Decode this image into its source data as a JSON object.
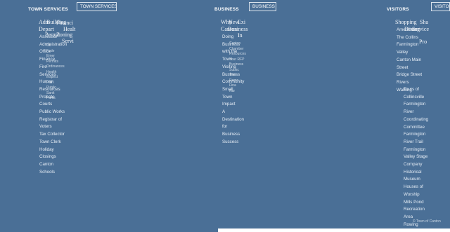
{
  "sections": {
    "town": {
      "header": "TOWN SERVICES",
      "dropdown": "TOWN SERVICES ▾",
      "overlap_title": [
        "Adm",
        "Building",
        "Financi",
        "Healt",
        "Servi",
        "Depart",
        "Permit",
        "Zoning"
      ],
      "items": [
        "Assessor",
        "Administration",
        "Office",
        "Finance",
        "Fire",
        "Services",
        "Human",
        "Resources",
        "Probate",
        "Courts",
        "Public Works",
        "Registrar of",
        "Voters",
        "Tax Collector",
        "Town Clerk",
        "Holiday",
        "Closings",
        "Canton",
        "Schools"
      ],
      "tiny_items": [
        "Cit",
        "Fede",
        "Emer",
        "Permits",
        "Ordinances",
        "Health",
        "Inspect",
        "Plan",
        "Public",
        "Sanit",
        "Parks"
      ]
    },
    "business": {
      "header": "BUSINESS",
      "dropdown": "BUSINESS ▾",
      "overlap_title": [
        "Why",
        "Canton",
        "New",
        "Business",
        "Exi",
        "In"
      ],
      "items": [
        "Doing",
        "Business",
        "with the",
        "Town",
        "Visiting",
        "Business",
        "Community",
        "Small",
        "Town",
        "Impact",
        "A",
        "Destination",
        "for",
        "Business",
        "Success"
      ],
      "tiny_items": [
        "Canton",
        "Chamber",
        "Resources",
        "Your RFP",
        "Business",
        "Subsc",
        "Tran",
        "Remo",
        "Fina",
        "Nar"
      ]
    },
    "visitors": {
      "header": "VISITORS",
      "dropdown": "VISITO",
      "overlap_title": [
        "Shopping",
        "Sha",
        "Dining",
        "Service",
        "Pro"
      ],
      "items": [
        "Tours of",
        "Collinsville",
        "Farmington",
        "River",
        "Coordinating",
        "Committee",
        "Farmington",
        "River Trail",
        "Farmington",
        "Valley Stage",
        "Company",
        "Historical",
        "Museum",
        "Houses of",
        "Worship",
        "Mills Pond",
        "Recreation",
        "Area",
        "Rowing"
      ],
      "left_items": [
        "Amenities",
        "The Collins",
        "Farmington",
        "Valley",
        "Canton Main",
        "Street",
        "Bridge Street",
        "Rivers",
        "Walking"
      ]
    }
  },
  "footer": "© Town of Canton"
}
